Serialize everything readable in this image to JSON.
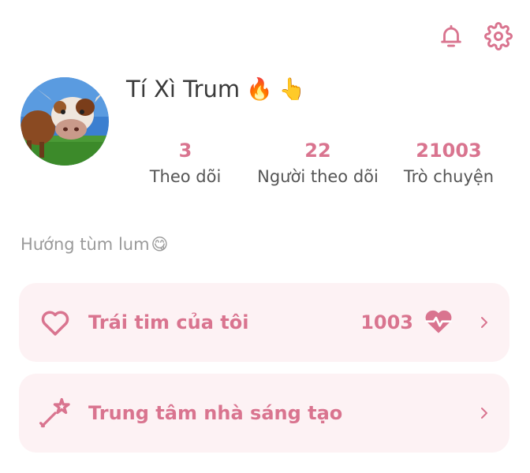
{
  "profile": {
    "name": "Tí Xì Trum",
    "name_emojis": [
      "🔥",
      "👆"
    ],
    "bio": "Hướng tùm lum",
    "bio_emoji": "😋"
  },
  "stats": [
    {
      "value": "3",
      "label": "Theo dõi"
    },
    {
      "value": "22",
      "label": "Người theo dõi"
    },
    {
      "value": "21003",
      "label": "Trò chuyện"
    }
  ],
  "menu": {
    "hearts": {
      "label": "Trái tim của tôi",
      "value": "1003",
      "icon": "heart-outline-icon"
    },
    "creator": {
      "label": "Trung tâm nhà sáng tạo",
      "icon": "magic-wand-icon"
    }
  },
  "colors": {
    "accent": "#d9748f",
    "card_bg": "#fdf2f4"
  }
}
